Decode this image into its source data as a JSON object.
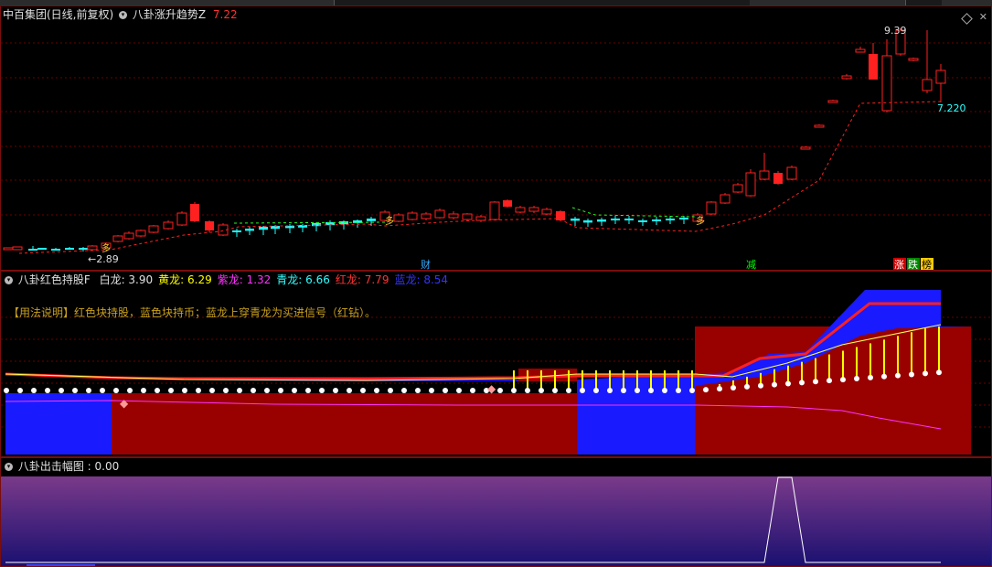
{
  "panel1": {
    "stock_title": "中百集团(日线,前复权)",
    "indicator_name": "八卦涨升趋势Z",
    "indicator_value": "7.22",
    "high_label": "9.39",
    "low_label": "2.89",
    "last_label": "7.220",
    "marks": [
      {
        "text": "财",
        "color": "#3af"
      },
      {
        "text": "减",
        "color": "#0f0"
      },
      {
        "text": "涨",
        "color": "#fff",
        "bg": "#c00"
      },
      {
        "text": "跌",
        "color": "#fff",
        "bg": "#080"
      },
      {
        "text": "榜",
        "color": "#000",
        "bg": "#fc0"
      }
    ],
    "duo_text": "多"
  },
  "panel2": {
    "indicator_name": "八卦红色持股F",
    "lines": [
      {
        "label": "白龙:",
        "value": "3.90",
        "color": "#ffffff"
      },
      {
        "label": "黄龙:",
        "value": "6.29",
        "color": "#ffff00"
      },
      {
        "label": "紫龙:",
        "value": "1.32",
        "color": "#ff33ff"
      },
      {
        "label": "青龙:",
        "value": "6.66",
        "color": "#33ffff"
      },
      {
        "label": "红龙:",
        "value": "7.79",
        "color": "#ff3333"
      },
      {
        "label": "蓝龙:",
        "value": "8.54",
        "color": "#3333ff"
      }
    ],
    "usage_note": "【用法说明】红色块持股，蓝色块持币；蓝龙上穿青龙为买进信号（红钻）。"
  },
  "panel3": {
    "indicator_name": "八卦出击幅图",
    "indicator_value": ": 0.00"
  },
  "colors": {
    "up": "#ff2020",
    "down": "#00ffff",
    "border": "#7a0d0d"
  },
  "icons": [
    "indicator-menu-icon",
    "diamond-icon",
    "close-icon"
  ]
}
